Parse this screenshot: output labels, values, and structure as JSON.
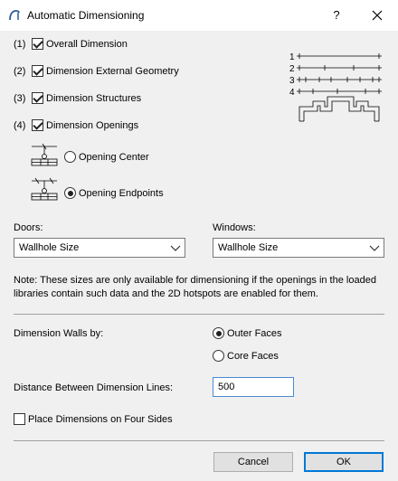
{
  "window": {
    "title": "Automatic Dimensioning",
    "help_label": "?",
    "close_label": "×"
  },
  "checks": [
    {
      "num": "(1)",
      "label": "Overall Dimension",
      "checked": true
    },
    {
      "num": "(2)",
      "label": "Dimension External Geometry",
      "checked": true
    },
    {
      "num": "(3)",
      "label": "Dimension Structures",
      "checked": true
    },
    {
      "num": "(4)",
      "label": "Dimension Openings",
      "checked": true
    }
  ],
  "diagram": {
    "line_numbers": [
      "1",
      "2",
      "3",
      "4"
    ]
  },
  "openings": {
    "options": [
      "Opening Center",
      "Opening Endpoints"
    ],
    "selected": "Opening Endpoints"
  },
  "doors": {
    "label": "Doors:",
    "value": "Wallhole Size"
  },
  "windows": {
    "label": "Windows:",
    "value": "Wallhole Size"
  },
  "note": "Note: These sizes are only available for dimensioning if the openings in the loaded libraries contain such data and the 2D hotspots are enabled for them.",
  "walls": {
    "label": "Dimension Walls by:",
    "options": [
      "Outer Faces",
      "Core Faces"
    ],
    "selected": "Outer Faces"
  },
  "distance": {
    "label": "Distance Between Dimension Lines:",
    "value": "500"
  },
  "four_sides": {
    "label": "Place Dimensions on Four Sides",
    "checked": false
  },
  "buttons": {
    "cancel": "Cancel",
    "ok": "OK"
  }
}
